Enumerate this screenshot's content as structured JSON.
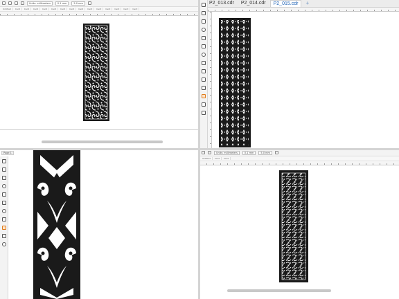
{
  "top_left": {
    "propbar": {
      "units": "Units: millimeters",
      "nudge": "0.1 mm",
      "dup": "5.0 mm"
    },
    "docbar": [
      "Untitled",
      "Cent",
      "Cent",
      "Cent",
      "Cent",
      "Cent",
      "Cent",
      "Cent",
      "Cent",
      "Cent",
      "Cent",
      "Cent",
      "Cent",
      "Cent",
      "Cent"
    ]
  },
  "top_right": {
    "tabs": [
      "P2_013.cdr",
      "P2_014.cdr",
      "P2_015.cdr"
    ],
    "active_tab": 2,
    "add_tab": "+"
  },
  "bottom_left": {
    "page_label": "Page 1"
  },
  "bottom_right": {
    "propbar": {
      "units": "Units: millimeters",
      "nudge": "0.1 mm",
      "dup": "5.0 mm"
    },
    "docbar": [
      "Untitled",
      "Cent",
      "Cent"
    ]
  },
  "colors": {
    "ink": "#1a1a1a",
    "tab_active": "#1a5fb4",
    "chrome": "#f3f3f3"
  },
  "icons": [
    "pick-tool-icon",
    "shape-tool-icon",
    "crop-tool-icon",
    "zoom-tool-icon",
    "freehand-tool-icon",
    "rectangle-tool-icon",
    "ellipse-tool-icon",
    "polygon-tool-icon",
    "text-tool-icon",
    "parallel-dimension-icon",
    "connector-icon",
    "drop-shadow-icon",
    "transparency-icon",
    "eyedropper-icon",
    "fill-icon"
  ]
}
